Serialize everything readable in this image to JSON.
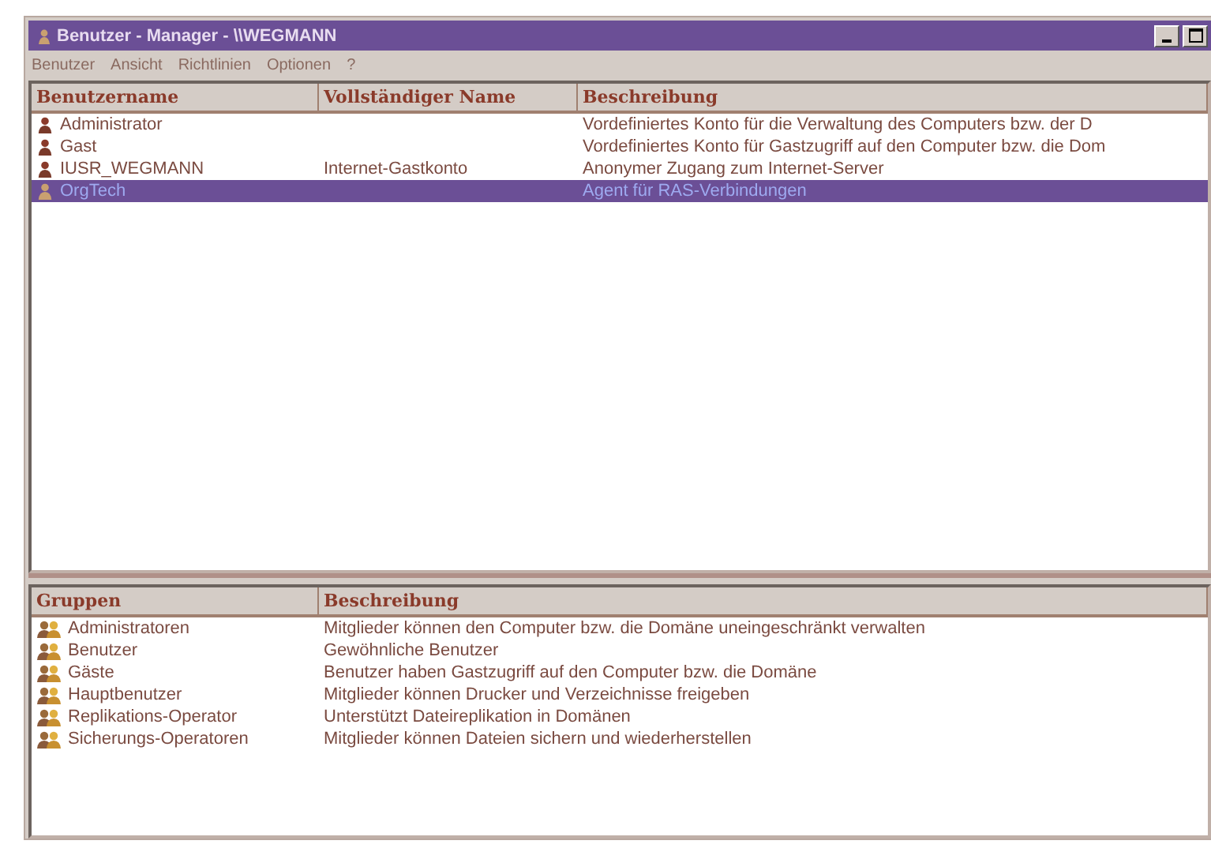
{
  "window": {
    "title": "Benutzer - Manager - \\\\WEGMANN"
  },
  "menu": [
    "Benutzer",
    "Ansicht",
    "Richtlinien",
    "Optionen",
    "?"
  ],
  "users": {
    "columns": [
      "Benutzername",
      "Vollständiger Name",
      "Beschreibung"
    ],
    "rows": [
      {
        "name": "Administrator",
        "full_name": "",
        "description": "Vordefiniertes Konto für die Verwaltung des Computers bzw. der D",
        "selected": false
      },
      {
        "name": "Gast",
        "full_name": "",
        "description": "Vordefiniertes Konto für Gastzugriff auf den Computer bzw. die Dom",
        "selected": false
      },
      {
        "name": "IUSR_WEGMANN",
        "full_name": "Internet-Gastkonto",
        "description": "Anonymer Zugang zum Internet-Server",
        "selected": false
      },
      {
        "name": "OrgTech",
        "full_name": "",
        "description": "Agent für RAS-Verbindungen",
        "selected": true
      }
    ]
  },
  "groups": {
    "columns": [
      "Gruppen",
      "Beschreibung"
    ],
    "rows": [
      {
        "name": "Administratoren",
        "description": "Mitglieder können den Computer bzw. die Domäne uneingeschränkt verwalten"
      },
      {
        "name": "Benutzer",
        "description": "Gewöhnliche Benutzer"
      },
      {
        "name": "Gäste",
        "description": "Benutzer haben Gastzugriff auf den Computer bzw. die Domäne"
      },
      {
        "name": "Hauptbenutzer",
        "description": "Mitglieder können Drucker und Verzeichnisse freigeben"
      },
      {
        "name": "Replikations-Operator",
        "description": "Unterstützt Dateireplikation in Domänen"
      },
      {
        "name": "Sicherungs-Operatoren",
        "description": "Mitglieder können Dateien sichern und wiederherstellen"
      }
    ]
  }
}
